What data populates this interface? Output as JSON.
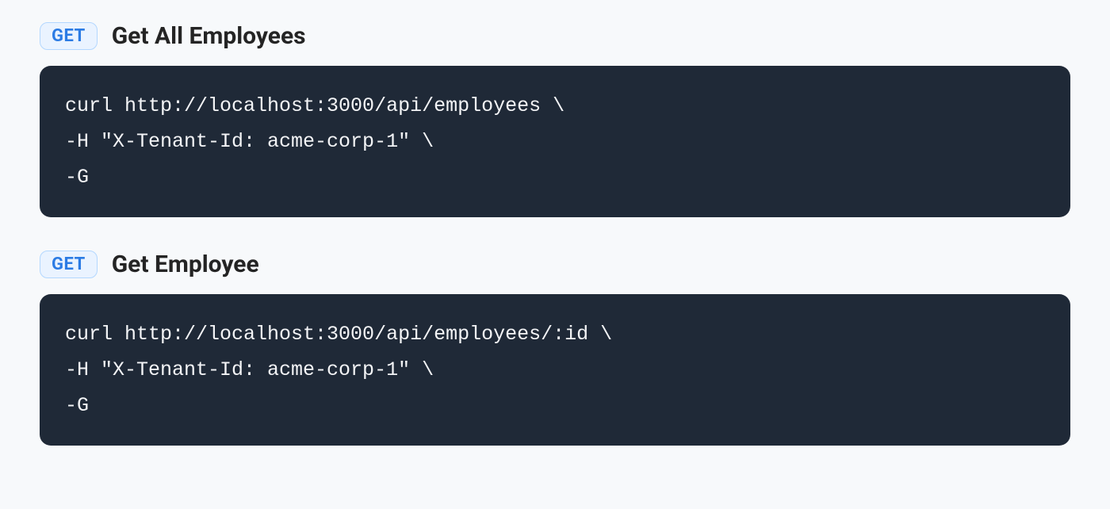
{
  "endpoints": [
    {
      "method": "GET",
      "title": "Get All Employees",
      "code": "curl http://localhost:3000/api/employees \\\n-H \"X-Tenant-Id: acme-corp-1\" \\\n-G"
    },
    {
      "method": "GET",
      "title": "Get Employee",
      "code": "curl http://localhost:3000/api/employees/:id \\\n-H \"X-Tenant-Id: acme-corp-1\" \\\n-G"
    }
  ]
}
